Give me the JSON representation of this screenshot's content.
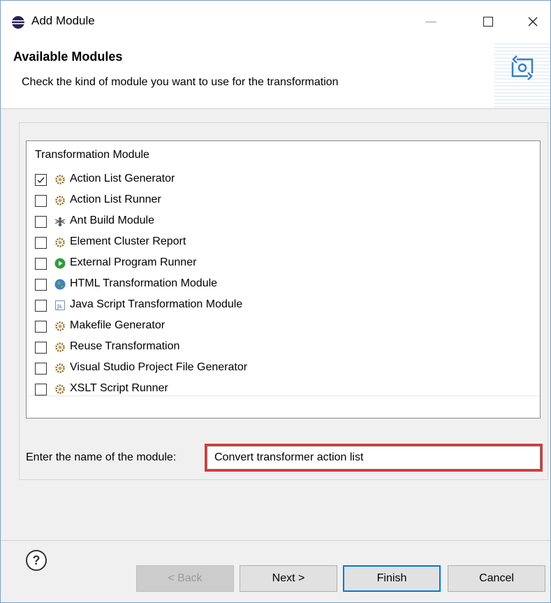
{
  "window": {
    "title": "Add Module",
    "controls": {
      "minimize": "—",
      "maximize": "☐",
      "close": "✕"
    }
  },
  "banner": {
    "title": "Available Modules",
    "description": "Check the kind of module you want to use for the transformation"
  },
  "list": {
    "header": "Transformation Module",
    "items": [
      {
        "label": "Action List Generator",
        "checked": true,
        "icon": "gear-icon"
      },
      {
        "label": "Action List Runner",
        "checked": false,
        "icon": "gear-icon"
      },
      {
        "label": "Ant Build Module",
        "checked": false,
        "icon": "ant-icon"
      },
      {
        "label": "Element Cluster Report",
        "checked": false,
        "icon": "gear-icon"
      },
      {
        "label": "External Program Runner",
        "checked": false,
        "icon": "play-icon"
      },
      {
        "label": "HTML Transformation Module",
        "checked": false,
        "icon": "globe-icon"
      },
      {
        "label": "Java Script Transformation Module",
        "checked": false,
        "icon": "javascript-file-icon"
      },
      {
        "label": "Makefile Generator",
        "checked": false,
        "icon": "gear-icon"
      },
      {
        "label": "Reuse Transformation",
        "checked": false,
        "icon": "gear-icon"
      },
      {
        "label": "Visual Studio Project File Generator",
        "checked": false,
        "icon": "gear-icon"
      },
      {
        "label": "XSLT Script Runner",
        "checked": false,
        "icon": "gear-icon"
      }
    ]
  },
  "name_field": {
    "label": "Enter the name of the module:",
    "value": "Convert transformer action list"
  },
  "buttons": {
    "help": "?",
    "back": "< Back",
    "next": "Next >",
    "finish": "Finish",
    "cancel": "Cancel"
  }
}
